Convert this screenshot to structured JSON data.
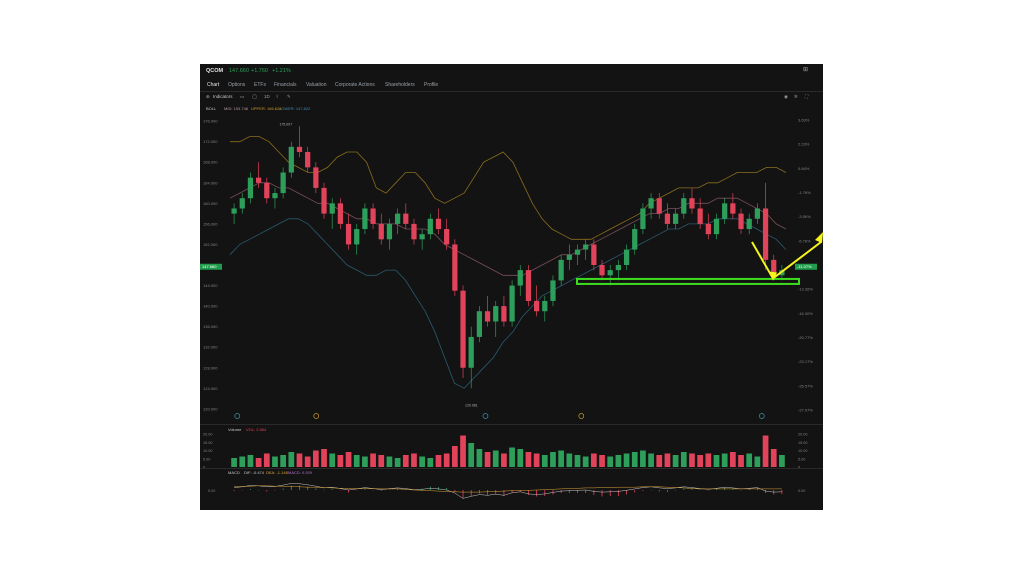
{
  "colors": {
    "up": "#2e9e5b",
    "down": "#e0435a",
    "upper_band": "#8a6d1e",
    "mid_band": "#7a4e5a",
    "lower_band": "#2a5b70",
    "annotation_yellow": "#f5f51a",
    "annotation_green": "#3ddc1e",
    "price_tag": "#1f9d4c",
    "bg": "#131313"
  },
  "header": {
    "symbol": "QCOM",
    "price": "147.660",
    "change": "+1.760",
    "change_pct": "+1.21%",
    "right_icon": "layout-icon"
  },
  "tabs": [
    "Chart",
    "Options",
    "ETFs",
    "Financials",
    "Valuation",
    "Corporate Actions",
    "Shareholders",
    "Profile"
  ],
  "toolbar": {
    "indicators_label": "Indicators",
    "interval_label": "1D",
    "right_icons": [
      "camera-icon",
      "settings-icon",
      "fullscreen-icon"
    ]
  },
  "boll": {
    "label": "BOLL",
    "mid": "MID: 153.746",
    "upper": "UPPER: 166.624",
    "lower": "LOWER: 147.822"
  },
  "price_axis": [
    "176.000",
    "172.000",
    "168.000",
    "164.000",
    "160.000",
    "156.000",
    "152.000",
    "148.000",
    "144.000",
    "140.000",
    "136.000",
    "132.000",
    "128.000",
    "124.000",
    "120.000"
  ],
  "pct_axis": [
    "3.63%",
    "2.23%",
    "0.84%",
    "-1.76%",
    "-3.56%",
    "-6.76%",
    "-11.07%",
    "-13.36%",
    "-16.30%",
    "-20.77%",
    "-23.17%",
    "-25.57%",
    "-27.97%"
  ],
  "current_price_tag": "147.660",
  "current_pct_tag": "-11.07%",
  "high_label": "175.007",
  "low_label": "120.081",
  "volume": {
    "label": "Volume",
    "value": "VOL: 2.564",
    "axis": [
      "20.00",
      "15.00",
      "10.00",
      "5.00",
      "0"
    ],
    "right_axis": [
      "20.00",
      "15.00",
      "10.00",
      "5.00",
      "0"
    ]
  },
  "macd": {
    "label": "MACD",
    "dif": "DIF: -0.474",
    "dea": "DEA: -1.148",
    "macd": "MACD: 0.929",
    "axis_left": "0.00",
    "axis_right": "0.00"
  },
  "chart_data": {
    "type": "candlestick",
    "ylim": [
      119,
      177
    ],
    "candles": [
      [
        158,
        160,
        156,
        159
      ],
      [
        159,
        162,
        158,
        161
      ],
      [
        161,
        166,
        160,
        165
      ],
      [
        165,
        168,
        163,
        164
      ],
      [
        164,
        165,
        160,
        161
      ],
      [
        161,
        163,
        159,
        162
      ],
      [
        162,
        167,
        161,
        166
      ],
      [
        166,
        172,
        165,
        171
      ],
      [
        171,
        175,
        169,
        170
      ],
      [
        170,
        171,
        166,
        167
      ],
      [
        167,
        168,
        162,
        163
      ],
      [
        163,
        164,
        157,
        158
      ],
      [
        158,
        161,
        155,
        160
      ],
      [
        160,
        161,
        155,
        156
      ],
      [
        156,
        158,
        151,
        152
      ],
      [
        152,
        156,
        150,
        155
      ],
      [
        155,
        160,
        154,
        159
      ],
      [
        159,
        160,
        155,
        156
      ],
      [
        156,
        158,
        152,
        153
      ],
      [
        153,
        157,
        151,
        156
      ],
      [
        156,
        159,
        154,
        158
      ],
      [
        158,
        160,
        155,
        156
      ],
      [
        156,
        157,
        152,
        153
      ],
      [
        153,
        155,
        151,
        154
      ],
      [
        154,
        158,
        153,
        157
      ],
      [
        157,
        159,
        154,
        155
      ],
      [
        155,
        157,
        151,
        152
      ],
      [
        152,
        153,
        142,
        143
      ],
      [
        143,
        144,
        126,
        128
      ],
      [
        128,
        136,
        124,
        134
      ],
      [
        134,
        140,
        133,
        139
      ],
      [
        139,
        142,
        136,
        137
      ],
      [
        137,
        141,
        134,
        140
      ],
      [
        140,
        142,
        136,
        137
      ],
      [
        137,
        145,
        136,
        144
      ],
      [
        144,
        148,
        142,
        147
      ],
      [
        147,
        148,
        140,
        141
      ],
      [
        141,
        144,
        138,
        139
      ],
      [
        139,
        142,
        137,
        141
      ],
      [
        141,
        146,
        140,
        145
      ],
      [
        145,
        150,
        144,
        149
      ],
      [
        149,
        152,
        147,
        150
      ],
      [
        150,
        152,
        148,
        151
      ],
      [
        151,
        153,
        149,
        152
      ],
      [
        152,
        153,
        147,
        148
      ],
      [
        148,
        149,
        145,
        146
      ],
      [
        146,
        148,
        144,
        147
      ],
      [
        147,
        149,
        145,
        148
      ],
      [
        148,
        152,
        147,
        151
      ],
      [
        151,
        156,
        150,
        155
      ],
      [
        155,
        160,
        154,
        159
      ],
      [
        159,
        162,
        157,
        161
      ],
      [
        161,
        162,
        157,
        158
      ],
      [
        158,
        160,
        155,
        156
      ],
      [
        156,
        159,
        155,
        158
      ],
      [
        158,
        162,
        157,
        161
      ],
      [
        161,
        163,
        158,
        159
      ],
      [
        159,
        161,
        155,
        156
      ],
      [
        156,
        158,
        153,
        154
      ],
      [
        154,
        158,
        153,
        157
      ],
      [
        157,
        161,
        156,
        160
      ],
      [
        160,
        162,
        157,
        158
      ],
      [
        158,
        159,
        154,
        155
      ],
      [
        155,
        158,
        154,
        157
      ],
      [
        157,
        160,
        156,
        159
      ],
      [
        159,
        164,
        147,
        149
      ],
      [
        149,
        150,
        145,
        146
      ],
      [
        146,
        148,
        145,
        147
      ]
    ],
    "volume": [
      6,
      7,
      8,
      6,
      9,
      7,
      8,
      10,
      9,
      7,
      11,
      12,
      9,
      8,
      10,
      8,
      7,
      9,
      8,
      7,
      6,
      8,
      9,
      7,
      6,
      8,
      9,
      14,
      21,
      16,
      12,
      10,
      11,
      9,
      13,
      12,
      10,
      9,
      8,
      10,
      11,
      9,
      8,
      7,
      9,
      8,
      7,
      8,
      9,
      10,
      11,
      9,
      8,
      9,
      8,
      10,
      9,
      8,
      9,
      8,
      9,
      10,
      8,
      9,
      7,
      21,
      12,
      8
    ],
    "bands": {
      "upper": [
        172,
        172,
        173,
        173,
        172,
        170,
        168,
        167,
        166,
        166,
        167,
        169,
        170,
        170,
        168,
        163,
        162,
        164,
        166,
        166,
        164,
        161,
        160,
        161,
        162,
        165,
        168,
        169,
        170,
        168,
        164,
        160,
        157,
        155,
        154,
        153,
        153,
        153,
        154,
        155,
        156,
        157,
        158,
        160,
        161,
        162,
        163,
        163,
        163,
        164,
        164,
        165,
        166,
        166,
        166,
        167,
        167,
        166
      ],
      "mid": [
        161,
        162,
        163,
        164,
        164,
        163,
        163,
        162,
        161,
        160,
        160,
        159,
        158,
        157,
        157,
        156,
        156,
        156,
        155,
        155,
        155,
        154,
        152,
        151,
        150,
        149,
        148,
        147,
        146,
        146,
        146,
        147,
        148,
        149,
        150,
        150,
        151,
        152,
        153,
        154,
        155,
        156,
        157,
        158,
        158,
        159,
        159,
        160,
        160,
        160,
        161,
        161,
        161,
        160,
        159,
        158,
        156,
        155
      ],
      "lower": [
        150,
        152,
        153,
        154,
        155,
        156,
        157,
        157,
        156,
        154,
        152,
        150,
        148,
        147,
        146,
        146,
        147,
        147,
        145,
        142,
        139,
        135,
        130,
        125,
        124,
        126,
        128,
        130,
        133,
        135,
        138,
        140,
        142,
        143,
        144,
        145,
        146,
        147,
        148,
        149,
        150,
        151,
        152,
        153,
        154,
        155,
        155,
        156,
        156,
        156,
        157,
        157,
        157,
        156,
        155,
        154,
        153,
        151
      ]
    },
    "annotations": {
      "support_level": 144.8,
      "v_arrow": "yellow",
      "support_box": "green"
    }
  }
}
